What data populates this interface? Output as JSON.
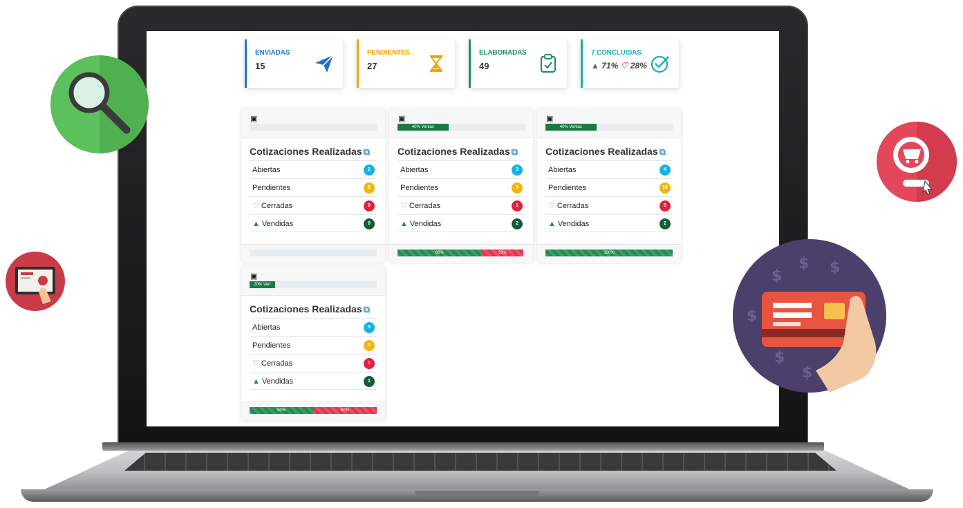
{
  "stats": [
    {
      "label": "ENVIADAS",
      "value": "15",
      "color": "#1f76d2",
      "icon": "paper-plane-icon"
    },
    {
      "label": "PENDIENTES",
      "value": "27",
      "color": "#f0a500",
      "icon": "hourglass-icon"
    },
    {
      "label": "ELABORADAS",
      "value": "49",
      "color": "#1f8f67",
      "icon": "clipboard-check-icon"
    },
    {
      "label": "7 CONCLUIDAS",
      "value_good": "71%",
      "value_bad": "28%",
      "color": "#14b3b0",
      "icon": "check-circle-icon"
    }
  ],
  "card_title": "Cotizaciones Realizadas",
  "row_labels": {
    "open": "Abiertas",
    "pending": "Pendientes",
    "closed": "Cerradas",
    "sold": "Vendidas"
  },
  "status_colors": {
    "open": "#17b1e8",
    "pending": "#f3b40c",
    "closed": "#e0213d",
    "sold": "#145e34"
  },
  "cards": [
    {
      "top_bar_text": "",
      "top_bar_fraction": 0,
      "counts": {
        "open": "2",
        "pending": "0",
        "closed": "0",
        "sold": "0"
      },
      "footer": []
    },
    {
      "top_bar_text": "40% Ventas",
      "top_bar_fraction": 0.4,
      "counts": {
        "open": "3",
        "pending": "3",
        "closed": "1",
        "sold": "2"
      },
      "footer": [
        {
          "text": "66%",
          "fraction": 0.66,
          "color": "#1f8a4c"
        },
        {
          "text": "33%",
          "fraction": 0.33,
          "color": "#e2344a"
        }
      ]
    },
    {
      "top_bar_text": "40% Ventas",
      "top_bar_fraction": 0.4,
      "counts": {
        "open": "4",
        "pending": "10",
        "closed": "0",
        "sold": "2"
      },
      "footer": [
        {
          "text": "100%",
          "fraction": 1.0,
          "color": "#1f8a4c"
        }
      ]
    },
    {
      "top_bar_text": "20% Ven",
      "top_bar_fraction": 0.2,
      "counts": {
        "open": "5",
        "pending": "0",
        "closed": "1",
        "sold": "1"
      },
      "footer": [
        {
          "text": "50%",
          "fraction": 0.5,
          "color": "#1f8a4c"
        },
        {
          "text": "50%",
          "fraction": 0.5,
          "color": "#e2344a"
        }
      ]
    }
  ]
}
